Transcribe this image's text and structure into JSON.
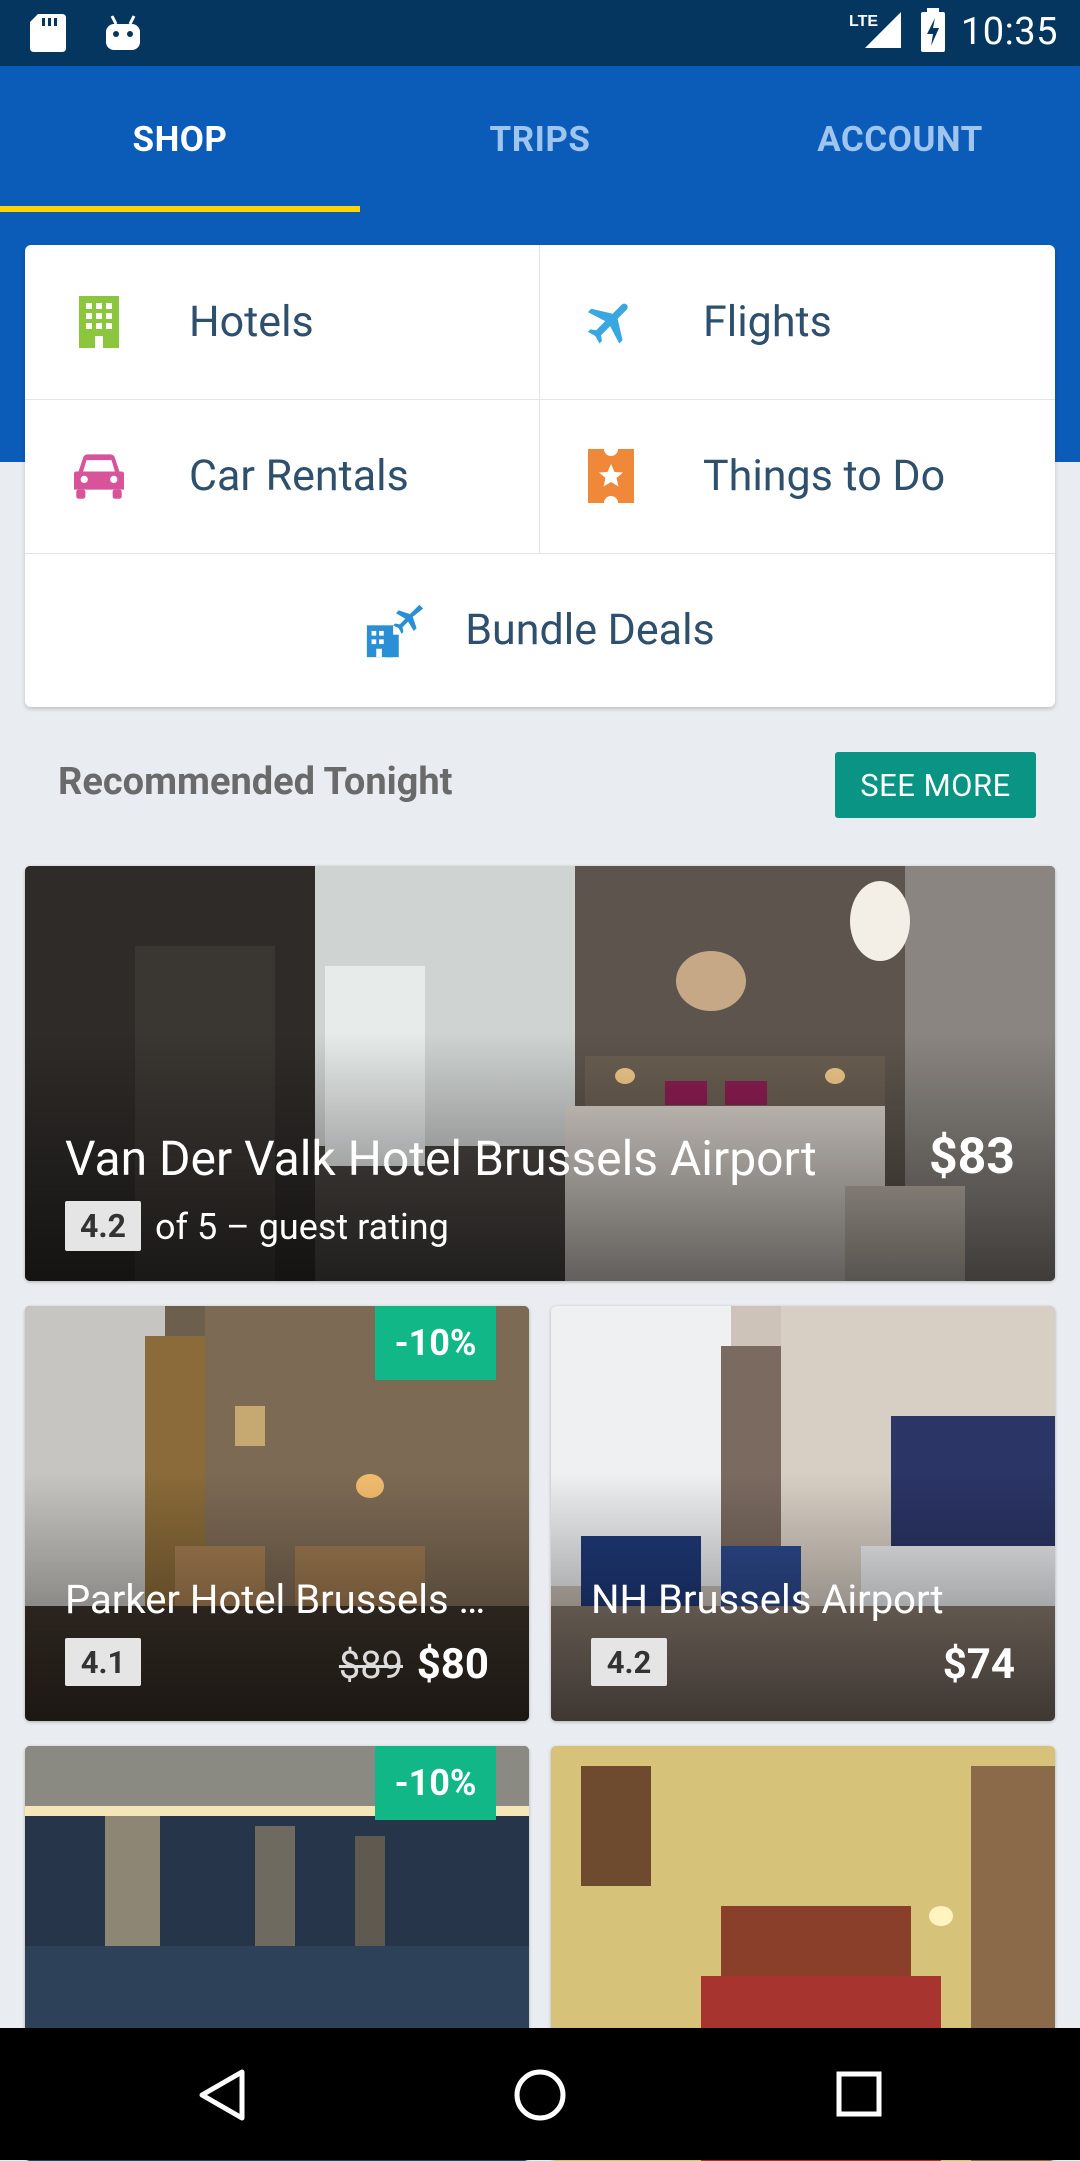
{
  "status_bar": {
    "time": "10:35",
    "network": "LTE"
  },
  "tabs": [
    {
      "label": "SHOP",
      "active": true
    },
    {
      "label": "TRIPS",
      "active": false
    },
    {
      "label": "ACCOUNT",
      "active": false
    }
  ],
  "menu": {
    "hotels": {
      "label": "Hotels",
      "icon": "building-icon",
      "color": "#8cc63f"
    },
    "flights": {
      "label": "Flights",
      "icon": "airplane-icon",
      "color": "#39a8e0"
    },
    "cars": {
      "label": "Car Rentals",
      "icon": "car-icon",
      "color": "#d9539b"
    },
    "things": {
      "label": "Things to Do",
      "icon": "ticket-star-icon",
      "color": "#f0883a"
    },
    "bundle": {
      "label": "Bundle Deals",
      "icon": "hotel-plane-icon",
      "color": "#2b8fd6"
    }
  },
  "recommended": {
    "title": "Recommended Tonight",
    "see_more": "SEE MORE",
    "featured": {
      "name": "Van Der Valk Hotel Brussels Airport",
      "rating": "4.2",
      "rating_text": "of 5 – guest rating",
      "price": "$83"
    },
    "hotels": [
      {
        "name": "Parker Hotel Brussels …",
        "rating": "4.1",
        "old_price": "$89",
        "price": "$80",
        "discount": "-10%"
      },
      {
        "name": "NH Brussels Airport",
        "rating": "4.2",
        "price": "$74"
      },
      {
        "discount": "-10%"
      },
      {}
    ]
  },
  "colors": {
    "status_bar": "#05365f",
    "app_bar": "#0b5bb9",
    "tab_indicator": "#ffd500",
    "see_more": "#0a9484",
    "discount": "#11b786"
  }
}
